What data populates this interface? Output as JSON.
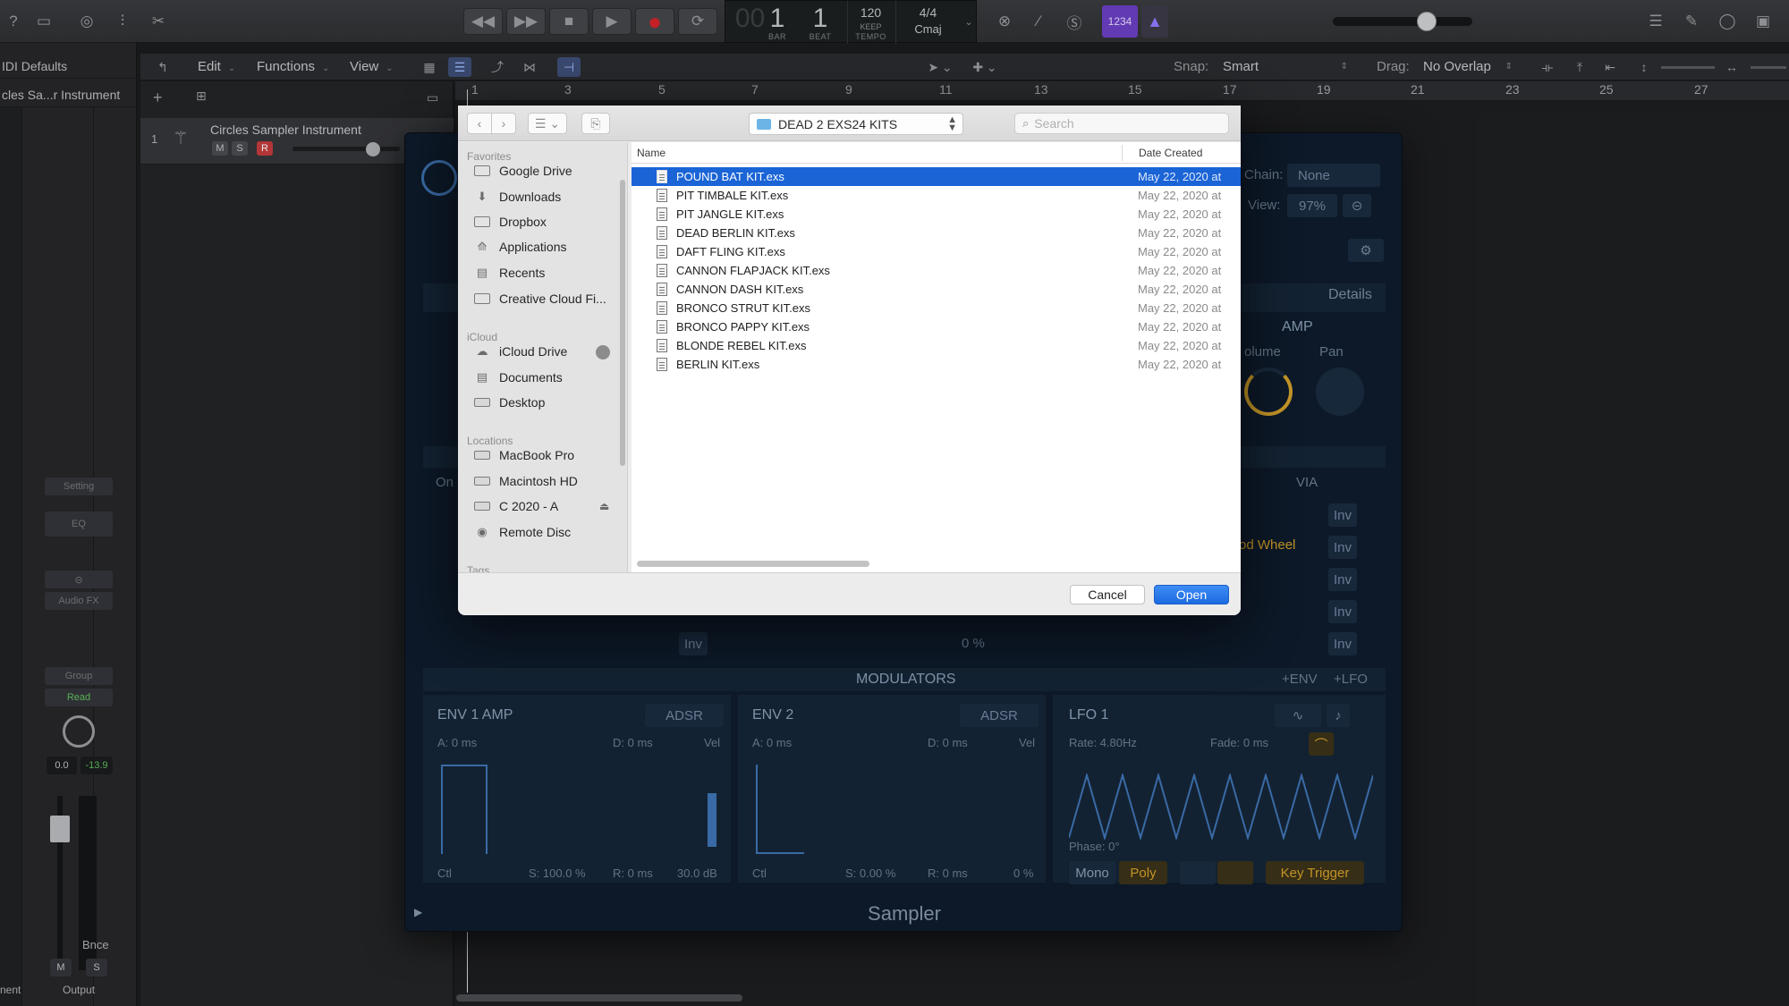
{
  "controlbar": {
    "lcd": {
      "bar": "1",
      "beat": "1",
      "bar_label": "BAR",
      "beat_label": "BEAT",
      "tempo": "120",
      "tempo_keep": "KEEP",
      "tempo_label": "TEMPO",
      "signature": "4/4",
      "key": "Cmaj",
      "ghost_digits": "00"
    },
    "count_in": "1234"
  },
  "inspector": {
    "region_header": "IDI Defaults",
    "track_header": "cles Sa...r Instrument",
    "setting_btn": "Setting",
    "eq_btn": "EQ",
    "audio_fx_btn": "Audio FX",
    "group_btn": "Group",
    "read_btn": "Read",
    "pan_value": "0.0",
    "level_value": "-13.9",
    "bnce_label": "Bnce",
    "mute_label": "M",
    "solo_label": "S",
    "left_label": "nent",
    "output_label": "Output"
  },
  "tracks": {
    "menus": [
      "Edit",
      "Functions",
      "View"
    ],
    "snap_label": "Snap:",
    "snap_value": "Smart",
    "drag_label": "Drag:",
    "drag_value": "No Overlap",
    "ruler_numbers": [
      "1",
      "3",
      "5",
      "7",
      "9",
      "11",
      "13",
      "15",
      "17",
      "19",
      "21",
      "23",
      "25",
      "27"
    ],
    "track1": {
      "number": "1",
      "name": "Circles Sampler Instrument",
      "mute": "M",
      "solo": "S",
      "record": "R"
    }
  },
  "sampler": {
    "title": "Sampler",
    "chain_label": "Chain:",
    "chain_value": "None",
    "view_label": "View:",
    "view_value": "97%",
    "details_tab": "Details",
    "amp_label": "AMP",
    "volume_label": "olume",
    "pan_label": "Pan",
    "via_label": "VIA",
    "mod_wheel": "od Wheel",
    "inv_label": "Inv",
    "on_label": "On",
    "zero_pct": "0 %",
    "modulators_label": "MODULATORS",
    "add_env": "+ENV",
    "add_lfo": "+LFO",
    "env1": {
      "title": "ENV 1 AMP",
      "mode": "ADSR",
      "a": "A: 0 ms",
      "d": "D: 0 ms",
      "s": "S: 100.0 %",
      "r": "R: 0 ms",
      "vel": "Vel",
      "vel_val": "30.0 dB",
      "ctrl": "Ctl"
    },
    "env2": {
      "title": "ENV 2",
      "mode": "ADSR",
      "a": "A: 0 ms",
      "d": "D: 0 ms",
      "s": "S: 0.00 %",
      "r": "R: 0 ms",
      "vel": "Vel",
      "vel_val": "0 %",
      "ctrl": "Ctl"
    },
    "lfo1": {
      "title": "LFO 1",
      "rate": "Rate: 4.80Hz",
      "fade": "Fade: 0 ms",
      "phase": "Phase: 0°"
    },
    "mono_btn": "Mono",
    "poly_btn": "Poly",
    "key_trigger_btn": "Key Trigger"
  },
  "dialog": {
    "current_folder": "DEAD 2 EXS24 KITS",
    "search_placeholder": "Search",
    "sidebar": {
      "favorites_label": "Favorites",
      "favorites": [
        "Google Drive",
        "Downloads",
        "Dropbox",
        "Applications",
        "Recents",
        "Creative Cloud Fi..."
      ],
      "icloud_label": "iCloud",
      "icloud": [
        "iCloud Drive",
        "Documents",
        "Desktop"
      ],
      "locations_label": "Locations",
      "locations": [
        "MacBook Pro",
        "Macintosh HD",
        "C 2020 - A",
        "Remote Disc"
      ],
      "tags_label": "Tags"
    },
    "columns": {
      "name": "Name",
      "date": "Date Created"
    },
    "files": [
      {
        "name": "POUND BAT KIT.exs",
        "date": "May 22, 2020 at"
      },
      {
        "name": "PIT TIMBALE KIT.exs",
        "date": "May 22, 2020 at"
      },
      {
        "name": "PIT JANGLE KIT.exs",
        "date": "May 22, 2020 at"
      },
      {
        "name": "DEAD BERLIN KIT.exs",
        "date": "May 22, 2020 at"
      },
      {
        "name": "DAFT FLING KIT.exs",
        "date": "May 22, 2020 at"
      },
      {
        "name": "CANNON FLAPJACK KIT.exs",
        "date": "May 22, 2020 at"
      },
      {
        "name": "CANNON DASH KIT.exs",
        "date": "May 22, 2020 at"
      },
      {
        "name": "BRONCO STRUT KIT.exs",
        "date": "May 22, 2020 at"
      },
      {
        "name": "BRONCO PAPPY KIT.exs",
        "date": "May 22, 2020 at"
      },
      {
        "name": "BLONDE REBEL KIT.exs",
        "date": "May 22, 2020 at"
      },
      {
        "name": "BERLIN KIT.exs",
        "date": "May 22, 2020 at"
      }
    ],
    "selected_file": "POUND BAT KIT.exs",
    "cancel_label": "Cancel",
    "open_label": "Open"
  },
  "colors": {
    "selection": "#1a64d6",
    "record": "#d5242a",
    "count_in": "#6b3fc3",
    "sampler_accent": "#d4a12b",
    "primary_button": "#1c6be0"
  }
}
